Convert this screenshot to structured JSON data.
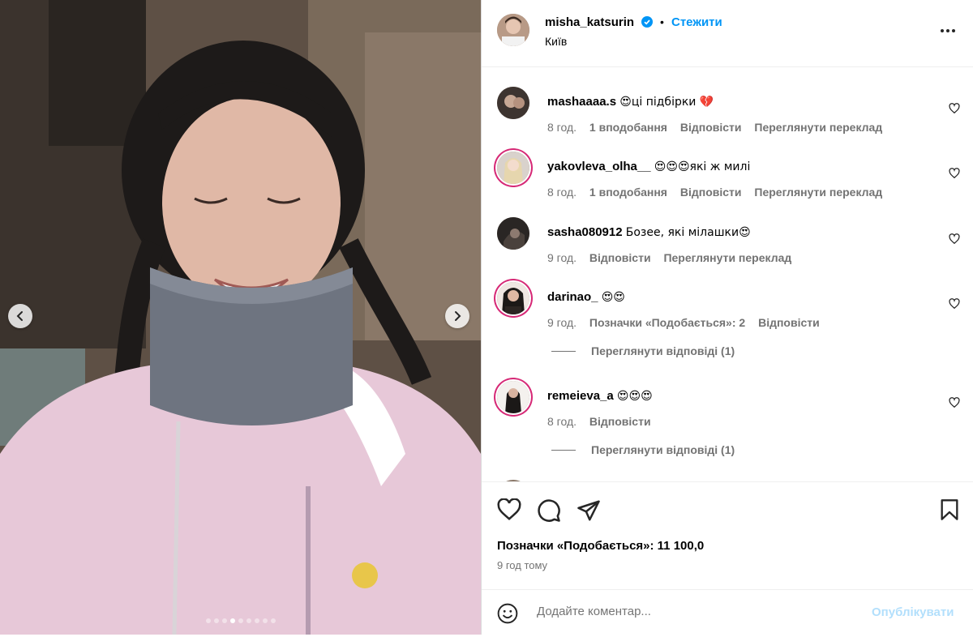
{
  "post": {
    "username": "misha_katsurin",
    "bullet": "•",
    "follow_label": "Стежити",
    "location": "Київ",
    "media_dots_count": 9,
    "media_active_dot": 3
  },
  "comments": [
    {
      "username": "mashaaaa.s",
      "text": "😍ці підбірки 💔",
      "time": "8 год.",
      "likes": "1 вподобання",
      "reply": "Відповісти",
      "translate": "Переглянути переклад"
    },
    {
      "username": "yakovleva_olha__",
      "text": "😍😍😍які ж милі",
      "time": "8 год.",
      "likes": "1 вподобання",
      "reply": "Відповісти",
      "translate": "Переглянути переклад"
    },
    {
      "username": "sasha080912",
      "text": "Бозее, які мілашки😍",
      "time": "9 год.",
      "reply": "Відповісти",
      "translate": "Переглянути переклад"
    },
    {
      "username": "darinao_",
      "text": "😍😍",
      "time": "9 год.",
      "likes": "Позначки «Подобається»: 2",
      "reply": "Відповісти",
      "view_replies": "Переглянути відповіді (1)"
    },
    {
      "username": "remeieva_a",
      "text": "😍😍😍",
      "time": "8 год.",
      "reply": "Відповісти",
      "view_replies": "Переглянути відповіді (1)"
    }
  ],
  "footer": {
    "likes_text": "Позначки «Подобається»: 11 100,0",
    "time_ago": "9 год тому",
    "comment_placeholder": "Додайте коментар...",
    "post_label": "Опублікувати"
  },
  "colors": {
    "accent": "#0095f6",
    "post_disabled": "#b2dffc",
    "muted": "#737373"
  }
}
